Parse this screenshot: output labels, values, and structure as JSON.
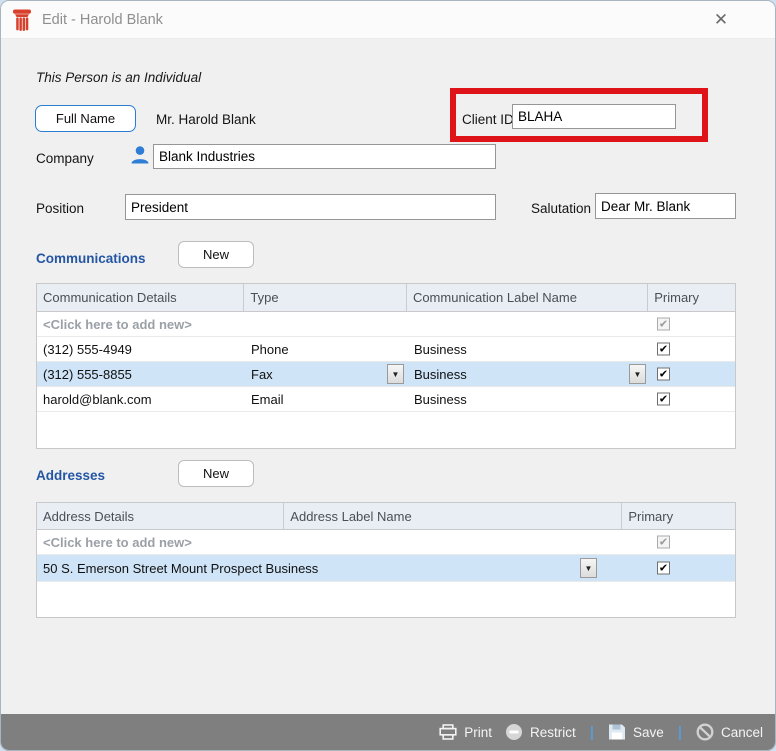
{
  "window": {
    "title": "Edit - Harold Blank"
  },
  "icons": {
    "close": "✕",
    "dropdown_arrow": "▼",
    "check": "✔",
    "separator": "|"
  },
  "header": {
    "individual_note": "This Person is an Individual"
  },
  "name_row": {
    "full_name_button": "Full Name",
    "full_name_value": "Mr. Harold Blank",
    "client_id_label": "Client ID",
    "client_id_value": "BLAHA"
  },
  "company_row": {
    "label": "Company",
    "value": "Blank Industries"
  },
  "position_row": {
    "label": "Position",
    "value": "President",
    "salutation_label": "Salutation",
    "salutation_value": "Dear Mr. Blank"
  },
  "communications": {
    "title": "Communications",
    "new_button": "New",
    "columns": [
      "Communication Details",
      "Type",
      "Communication Label Name",
      "Primary"
    ],
    "add_new": "<Click here to add new>",
    "rows": [
      {
        "details": "(312) 555-4949",
        "type": "Phone",
        "label": "Business",
        "primary": true,
        "selected": false
      },
      {
        "details": "(312) 555-8855",
        "type": "Fax",
        "label": "Business",
        "primary": true,
        "selected": true
      },
      {
        "details": "harold@blank.com",
        "type": "Email",
        "label": "Business",
        "primary": true,
        "selected": false
      }
    ]
  },
  "addresses": {
    "title": "Addresses",
    "new_button": "New",
    "columns": [
      "Address Details",
      "Address Label Name",
      "Primary"
    ],
    "add_new": "<Click here to add new>",
    "rows": [
      {
        "details": "50 S. Emerson Street  Mount Prospect  Business",
        "primary": true,
        "selected": true
      }
    ]
  },
  "toolbar": {
    "print": "Print",
    "restrict": "Restrict",
    "save": "Save",
    "cancel": "Cancel"
  },
  "colors": {
    "accent_blue": "#2b7cd3",
    "section_blue": "#2456a4",
    "selected_row": "#cfe4f7",
    "annotation_red": "#df1418",
    "toolbar_gray": "#7f7f7f",
    "header_bg": "#e9eef4"
  }
}
